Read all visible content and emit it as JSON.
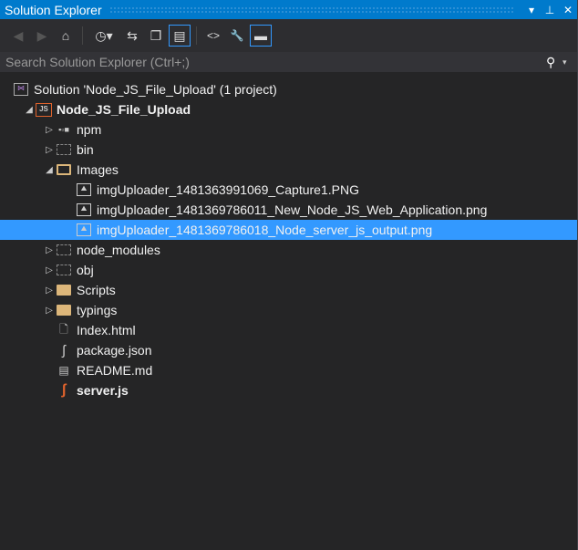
{
  "title": "Solution Explorer",
  "title_buttons": {
    "dropdown": "▾",
    "pin": "⊥",
    "close": "✕"
  },
  "toolbar": {
    "back": "◀",
    "forward": "▶",
    "home": "⌂",
    "pending": "◷▾",
    "sync": "⇆",
    "collapse": "❐",
    "show_all": "▤",
    "code": "<>",
    "properties": "🔧",
    "preview": "▬"
  },
  "search": {
    "placeholder": "Search Solution Explorer (Ctrl+;)",
    "icon": "⚲",
    "dropdown": "▾"
  },
  "tree": [
    {
      "label": "Solution 'Node_JS_File_Upload' (1 project)",
      "icon": "solution-icon",
      "level": 0
    },
    {
      "label": "Node_JS_File_Upload",
      "icon": "js-project-icon",
      "level": 1,
      "expanded": true,
      "bold": true
    },
    {
      "label": "npm",
      "icon": "npm-icon",
      "level": 2,
      "expanded": false
    },
    {
      "label": "bin",
      "icon": "hidden-folder-icon",
      "level": 2,
      "expanded": false
    },
    {
      "label": "Images",
      "icon": "open-folder-icon",
      "level": 2,
      "expanded": true
    },
    {
      "label": "imgUploader_1481363991069_Capture1.PNG",
      "icon": "image-file-icon",
      "level": 3
    },
    {
      "label": "imgUploader_1481369786011_New_Node_JS_Web_Application.png",
      "icon": "image-file-icon",
      "level": 3
    },
    {
      "label": "imgUploader_1481369786018_Node_server_js_output.png",
      "icon": "image-file-icon",
      "level": 3,
      "selected": true
    },
    {
      "label": "node_modules",
      "icon": "hidden-folder-icon",
      "level": 2,
      "expanded": false
    },
    {
      "label": "obj",
      "icon": "hidden-folder-icon",
      "level": 2,
      "expanded": false
    },
    {
      "label": "Scripts",
      "icon": "folder-icon",
      "level": 2,
      "expanded": false
    },
    {
      "label": "typings",
      "icon": "folder-icon",
      "level": 2,
      "expanded": false
    },
    {
      "label": "Index.html",
      "icon": "html-file-icon",
      "level": 2
    },
    {
      "label": "package.json",
      "icon": "json-file-icon",
      "level": 2
    },
    {
      "label": "README.md",
      "icon": "text-file-icon",
      "level": 2
    },
    {
      "label": "server.js",
      "icon": "js-file-icon",
      "level": 2,
      "bold": true
    }
  ],
  "colors": {
    "accent": "#007acc",
    "selection": "#3399ff",
    "background": "#252526"
  }
}
